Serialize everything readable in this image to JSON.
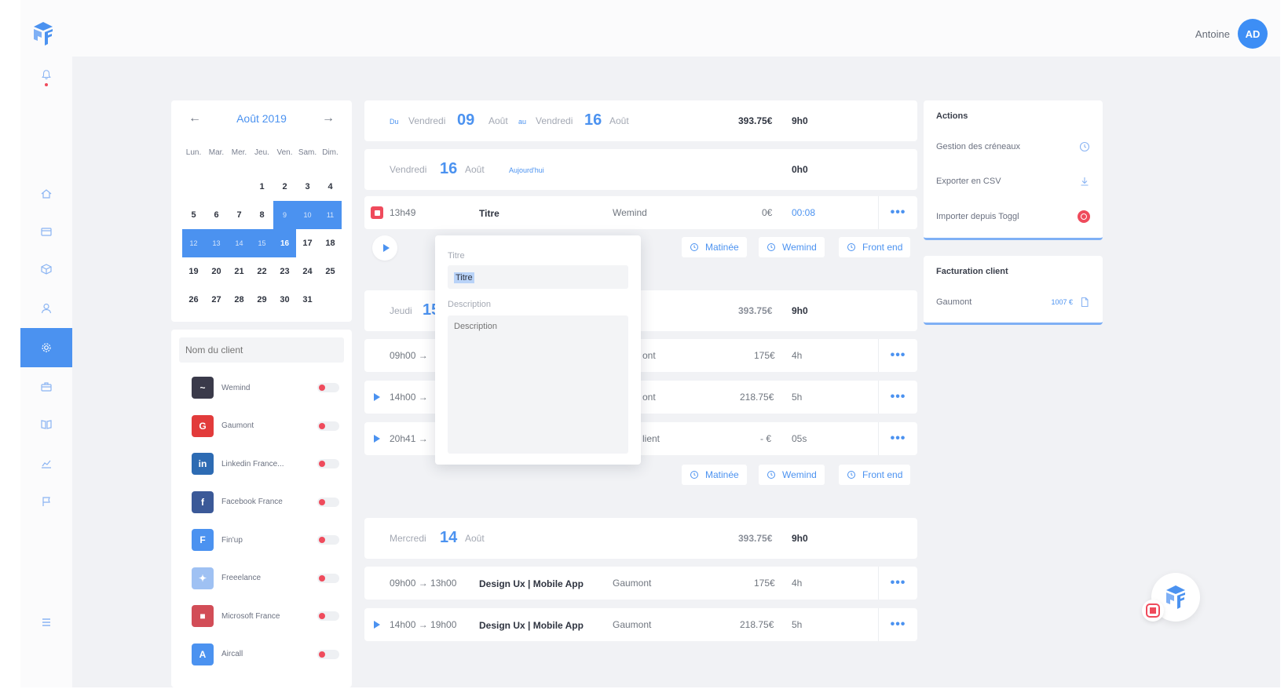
{
  "topbar": {
    "user_name": "Antoine",
    "avatar_initials": "AD"
  },
  "colors": {
    "accent": "#4b92f0",
    "danger": "#ef4b5c",
    "background": "#f1f2f5"
  },
  "sidebar": {
    "icons": [
      "bell-icon",
      "home-icon",
      "card-icon",
      "box-icon",
      "user-icon",
      "gear-icon",
      "briefcase-icon",
      "book-icon",
      "chart-icon",
      "flag-icon",
      "menu-icon"
    ],
    "active": "gear-icon"
  },
  "calendar": {
    "month_label": "Août 2019",
    "weekdays": [
      "Lun.",
      "Mar.",
      "Mer.",
      "Jeu.",
      "Ven.",
      "Sam.",
      "Dim."
    ],
    "days": [
      "",
      "",
      "",
      "1",
      "2",
      "3",
      "4",
      "5",
      "6",
      "7",
      "8",
      "9",
      "10",
      "11",
      "12",
      "13",
      "14",
      "15",
      "16",
      "17",
      "18",
      "19",
      "20",
      "21",
      "22",
      "23",
      "24",
      "25",
      "26",
      "27",
      "28",
      "29",
      "30",
      "31",
      ""
    ],
    "selected_range": [
      "9",
      "16"
    ]
  },
  "clients": {
    "search_placeholder": "Nom du client",
    "items": [
      {
        "name": "Wemind",
        "initial": "~",
        "color": "#3a3a4a"
      },
      {
        "name": "Gaumont",
        "initial": "G",
        "color": "#e23b3b"
      },
      {
        "name": "Linkedin France...",
        "initial": "in",
        "color": "#2d6bb3"
      },
      {
        "name": "Facebook France",
        "initial": "f",
        "color": "#3b5998"
      },
      {
        "name": "Fin'up",
        "initial": "F",
        "color": "#4b92f0"
      },
      {
        "name": "Freeelance",
        "initial": "✦",
        "color": "#9fc1f3"
      },
      {
        "name": "Microsoft France",
        "initial": "■",
        "color": "#d24d57"
      },
      {
        "name": "Aircall",
        "initial": "A",
        "color": "#4b92f0"
      }
    ]
  },
  "week_header": {
    "du": "Du",
    "start_day": "Vendredi",
    "start_date": "09",
    "start_month": "Août",
    "au": "au",
    "end_day": "Vendredi",
    "end_date": "16",
    "end_month": "Août",
    "amount": "393.75€",
    "hours": "9h0"
  },
  "day_16": {
    "day": "Vendredi",
    "date": "16",
    "month": "Août",
    "today": "Aujourd'hui",
    "hours": "0h0"
  },
  "running_entry": {
    "time": "13h49",
    "title": "Titre",
    "client": "Wemind",
    "amount": "0€",
    "duration": "00:08",
    "more": "•••"
  },
  "tags": [
    "Matinée",
    "Wemind",
    "Front end"
  ],
  "day_15": {
    "day": "Jeudi",
    "date": "15",
    "amount": "393.75€",
    "hours": "9h0"
  },
  "day_15_entries": [
    {
      "time": "09h00 →",
      "client_partial": "ont",
      "amount": "175€",
      "hours": "4h",
      "more": "•••"
    },
    {
      "time": "14h00 →",
      "client_partial": "ont",
      "amount": "218.75€",
      "hours": "5h",
      "more": "•••"
    },
    {
      "time": "20h41 →",
      "client_partial": "lient",
      "amount": "- €",
      "hours": "05s",
      "more": "•••"
    }
  ],
  "day_14": {
    "day": "Mercredi",
    "date": "14",
    "month": "Août",
    "amount": "393.75€",
    "hours": "9h0"
  },
  "day_14_entries": [
    {
      "time": "09h00 → 13h00",
      "title": "Design Ux | Mobile App",
      "client": "Gaumont",
      "amount": "175€",
      "hours": "4h",
      "more": "•••"
    },
    {
      "time": "14h00 → 19h00",
      "title": "Design Ux | Mobile App",
      "client": "Gaumont",
      "amount": "218.75€",
      "hours": "5h",
      "more": "•••"
    }
  ],
  "popup": {
    "title_label": "Titre",
    "title_value": "Titre",
    "description_label": "Description",
    "description_placeholder": "Description"
  },
  "actions": {
    "title": "Actions",
    "items": [
      "Gestion des créneaux",
      "Exporter en CSV",
      "Importer depuis Toggl"
    ]
  },
  "billing": {
    "title": "Facturation client",
    "client": "Gaumont",
    "amount": "1007 €"
  }
}
